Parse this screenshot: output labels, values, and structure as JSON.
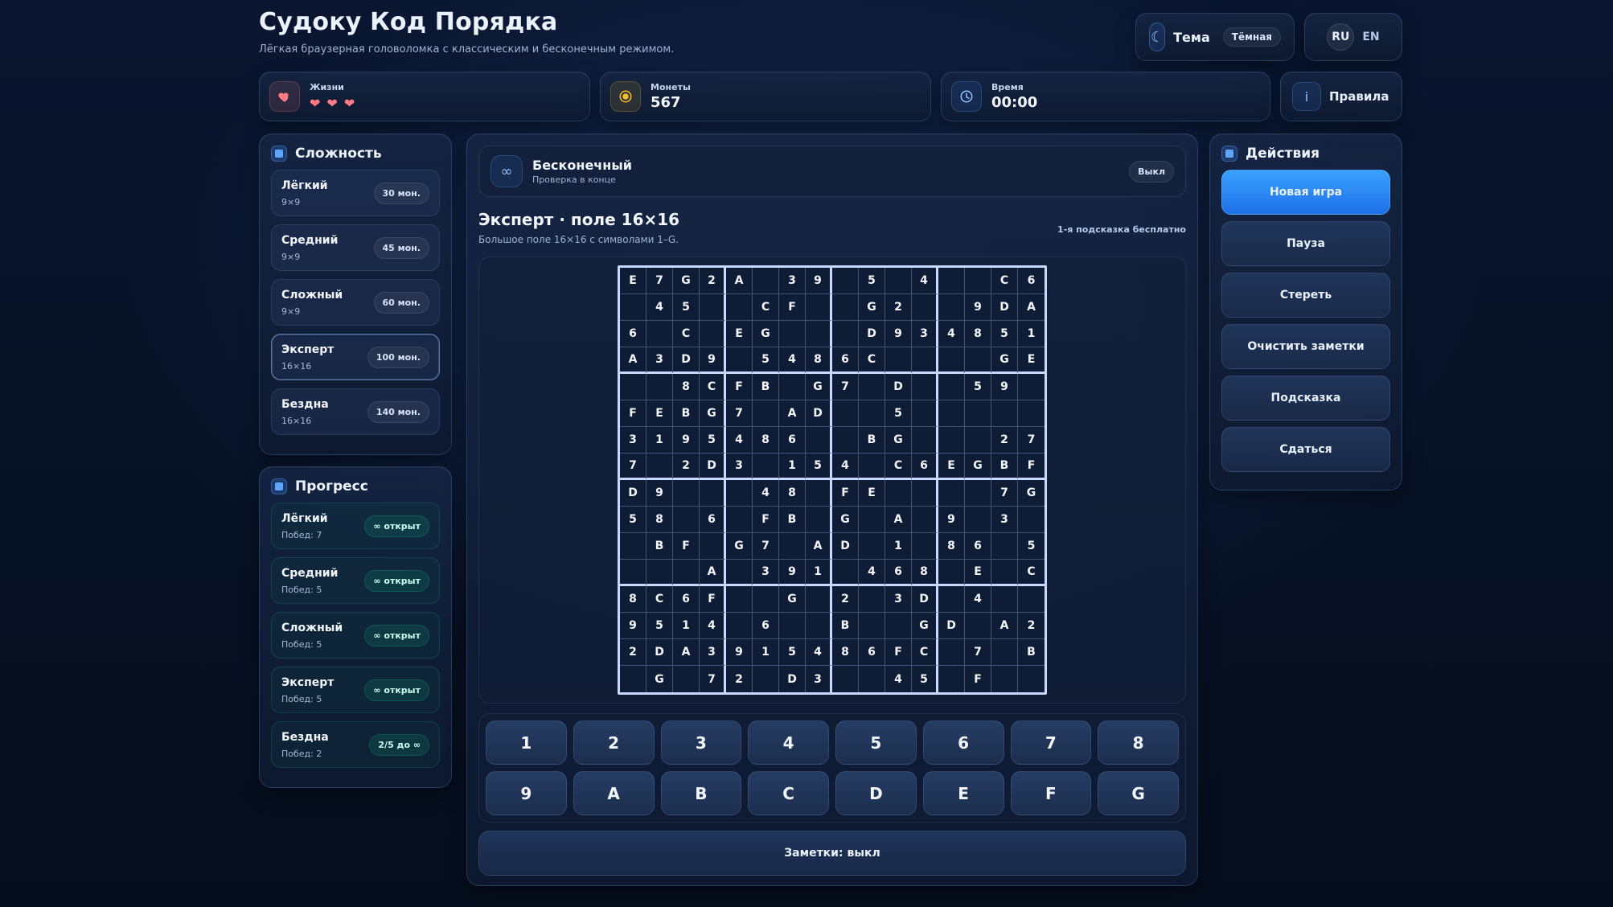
{
  "header": {
    "title": "Судоку Код Порядка",
    "subtitle": "Лёгкая браузерная головоломка с классическим и бесконечным режимом.",
    "theme_label": "Тема",
    "theme_value": "Тёмная",
    "lang_ru": "RU",
    "lang_en": "EN"
  },
  "stats": {
    "lives_label": "Жизни",
    "lives_count": 3,
    "coins_label": "Монеты",
    "coins_value": "567",
    "time_label": "Время",
    "time_value": "00:00",
    "rules_label": "Правила"
  },
  "difficulty": {
    "title": "Сложность",
    "items": [
      {
        "name": "Лёгкий",
        "size": "9×9",
        "reward": "30 мон."
      },
      {
        "name": "Средний",
        "size": "9×9",
        "reward": "45 мон."
      },
      {
        "name": "Сложный",
        "size": "9×9",
        "reward": "60 мон."
      },
      {
        "name": "Эксперт",
        "size": "16×16",
        "reward": "100 мон."
      },
      {
        "name": "Бездна",
        "size": "16×16",
        "reward": "140 мон."
      }
    ],
    "active_index": 3
  },
  "progress": {
    "title": "Прогресс",
    "items": [
      {
        "name": "Лёгкий",
        "wins": "Побед: 7",
        "badge": "∞ открыт"
      },
      {
        "name": "Средний",
        "wins": "Побед: 5",
        "badge": "∞ открыт"
      },
      {
        "name": "Сложный",
        "wins": "Побед: 5",
        "badge": "∞ открыт"
      },
      {
        "name": "Эксперт",
        "wins": "Побед: 5",
        "badge": "∞ открыт"
      },
      {
        "name": "Бездна",
        "wins": "Побед: 2",
        "badge": "2/5 до ∞"
      }
    ]
  },
  "mode": {
    "title": "Бесконечный",
    "subtitle": "Проверка в конце",
    "toggle": "Выкл"
  },
  "level": {
    "title": "Эксперт · поле 16×16",
    "subtitle": "Большое поле 16×16 с символами 1–G.",
    "hint": "1-я подсказка бесплатно"
  },
  "board": {
    "rows": [
      [
        "E",
        "7",
        "G",
        "2",
        "A",
        "",
        "3",
        "9",
        "",
        "5",
        "",
        "4",
        "",
        "",
        "C",
        "6"
      ],
      [
        "",
        "4",
        "5",
        "",
        "",
        "C",
        "F",
        "",
        "",
        "G",
        "2",
        "",
        "",
        "9",
        "D",
        "A"
      ],
      [
        "6",
        "",
        "C",
        "",
        "E",
        "G",
        "",
        "",
        "",
        "D",
        "9",
        "3",
        "4",
        "8",
        "5",
        "1"
      ],
      [
        "A",
        "3",
        "D",
        "9",
        "",
        "5",
        "4",
        "8",
        "6",
        "C",
        "",
        "",
        "",
        "",
        "G",
        "E"
      ],
      [
        "",
        "",
        "8",
        "C",
        "F",
        "B",
        "",
        "G",
        "7",
        "",
        "D",
        "",
        "",
        "5",
        "9",
        ""
      ],
      [
        "F",
        "E",
        "B",
        "G",
        "7",
        "",
        "A",
        "D",
        "",
        "",
        "5",
        "",
        "",
        "",
        "",
        ""
      ],
      [
        "3",
        "1",
        "9",
        "5",
        "4",
        "8",
        "6",
        "",
        "",
        "B",
        "G",
        "",
        "",
        "",
        "2",
        "7"
      ],
      [
        "7",
        "",
        "2",
        "D",
        "3",
        "",
        "1",
        "5",
        "4",
        "",
        "C",
        "6",
        "E",
        "G",
        "B",
        "F"
      ],
      [
        "D",
        "9",
        "",
        "",
        "",
        "4",
        "8",
        "",
        "F",
        "E",
        "",
        "",
        "",
        "",
        "7",
        "G"
      ],
      [
        "5",
        "8",
        "",
        "6",
        "",
        "F",
        "B",
        "",
        "G",
        "",
        "A",
        "",
        "9",
        "",
        "3",
        ""
      ],
      [
        "",
        "B",
        "F",
        "",
        "G",
        "7",
        "",
        "A",
        "D",
        "",
        "1",
        "",
        "8",
        "6",
        "",
        "5"
      ],
      [
        "",
        "",
        "",
        "A",
        "",
        "3",
        "9",
        "1",
        "",
        "4",
        "6",
        "8",
        "",
        "E",
        "",
        "C"
      ],
      [
        "8",
        "C",
        "6",
        "F",
        "",
        "",
        "G",
        "",
        "2",
        "",
        "3",
        "D",
        "",
        "4",
        "",
        ""
      ],
      [
        "9",
        "5",
        "1",
        "4",
        "",
        "6",
        "",
        "",
        "B",
        "",
        "",
        "G",
        "D",
        "",
        "A",
        "2"
      ],
      [
        "2",
        "D",
        "A",
        "3",
        "9",
        "1",
        "5",
        "4",
        "8",
        "6",
        "F",
        "C",
        "",
        "7",
        "",
        "B"
      ],
      [
        "",
        "G",
        "",
        "7",
        "2",
        "",
        "D",
        "3",
        "",
        "",
        "4",
        "5",
        "",
        "F",
        "",
        ""
      ]
    ]
  },
  "keypad": [
    "1",
    "2",
    "3",
    "4",
    "5",
    "6",
    "7",
    "8",
    "9",
    "A",
    "B",
    "C",
    "D",
    "E",
    "F",
    "G"
  ],
  "notes_label": "Заметки: выкл",
  "actions": {
    "title": "Действия",
    "buttons": [
      "Новая игра",
      "Пауза",
      "Стереть",
      "Очистить заметки",
      "Подсказка",
      "Сдаться"
    ]
  },
  "colors": {
    "accent": "#3aa2ff",
    "heart": "#ff7c86",
    "coin": "#fbbf24",
    "board_border": "#c9d8ff"
  }
}
